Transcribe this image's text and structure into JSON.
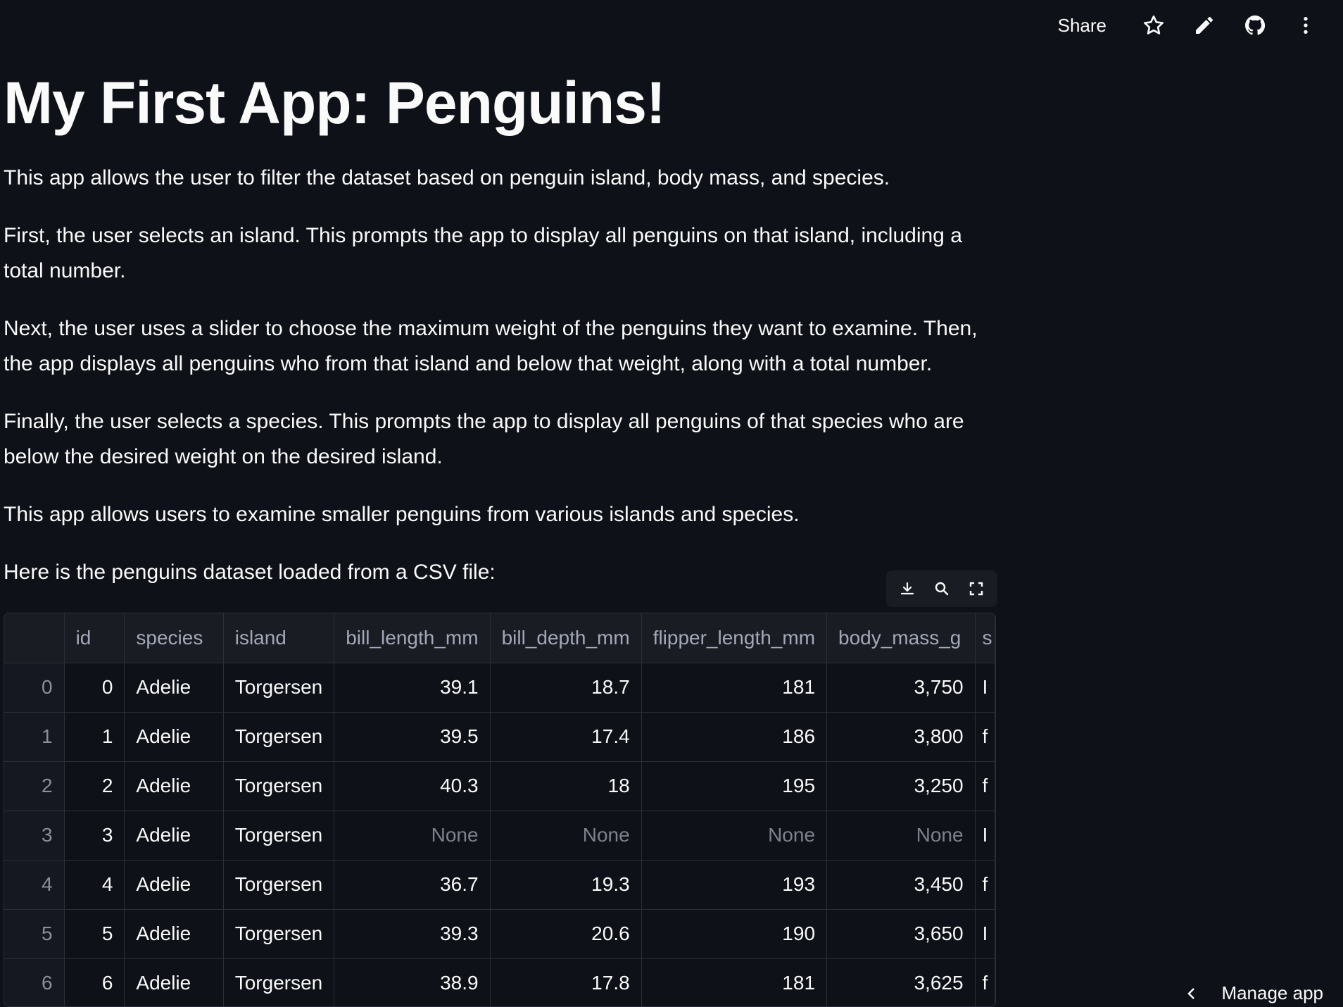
{
  "toolbar": {
    "share_label": "Share",
    "icons": [
      "star-icon",
      "pencil-icon",
      "github-icon",
      "more-vertical-icon"
    ]
  },
  "title": "My First App: Penguins!",
  "paragraphs": [
    "This app allows the user to filter the dataset based on penguin island, body mass, and species.",
    "First, the user selects an island. This prompts the app to display all penguins on that island, including a total number.",
    "Next, the user uses a slider to choose the maximum weight of the penguins they want to examine. Then, the app displays all penguins who from that island and below that weight, along with a total number.",
    "Finally, the user selects a species. This prompts the app to display all penguins of that species who are below the desired weight on the desired island.",
    "This app allows users to examine smaller penguins from various islands and species.",
    "Here is the penguins dataset loaded from a CSV file:"
  ],
  "dataframe": {
    "toolbar_icons": [
      "download-icon",
      "search-icon",
      "fullscreen-icon"
    ],
    "columns": [
      "",
      "id",
      "species",
      "island",
      "bill_length_mm",
      "bill_depth_mm",
      "flipper_length_mm",
      "body_mass_g",
      "s"
    ],
    "rows": [
      [
        "0",
        "0",
        "Adelie",
        "Torgersen",
        "39.1",
        "18.7",
        "181",
        "3,750",
        "I"
      ],
      [
        "1",
        "1",
        "Adelie",
        "Torgersen",
        "39.5",
        "17.4",
        "186",
        "3,800",
        "f"
      ],
      [
        "2",
        "2",
        "Adelie",
        "Torgersen",
        "40.3",
        "18",
        "195",
        "3,250",
        "f"
      ],
      [
        "3",
        "3",
        "Adelie",
        "Torgersen",
        "None",
        "None",
        "None",
        "None",
        "I"
      ],
      [
        "4",
        "4",
        "Adelie",
        "Torgersen",
        "36.7",
        "19.3",
        "193",
        "3,450",
        "f"
      ],
      [
        "5",
        "5",
        "Adelie",
        "Torgersen",
        "39.3",
        "20.6",
        "190",
        "3,650",
        "I"
      ],
      [
        "6",
        "6",
        "Adelie",
        "Torgersen",
        "38.9",
        "17.8",
        "181",
        "3,625",
        "f"
      ]
    ]
  },
  "manage_app_label": "Manage app"
}
